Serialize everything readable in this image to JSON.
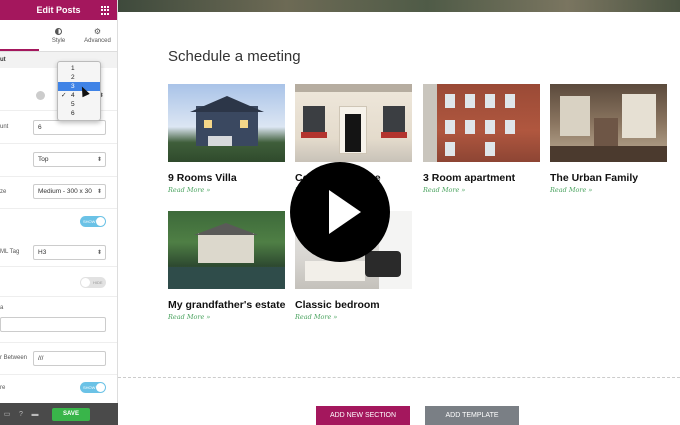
{
  "panel": {
    "title": "Edit Posts",
    "tabs": [
      {
        "label": ""
      },
      {
        "label": "Style",
        "icon": "half-circle-icon"
      },
      {
        "label": "Advanced",
        "icon": "gear-icon"
      }
    ],
    "section_label": "ut",
    "controls": {
      "posts_count_label": "unt",
      "posts_count_value": "6",
      "image_position_value": "Top",
      "image_size_label": "ze",
      "image_size_value": "Medium - 300 x 30",
      "title_tag_label": "ML Tag",
      "title_tag_value": "H3",
      "toggle_on_label": "SHOW",
      "toggle_off_label": "HIDE",
      "meta_label": "a",
      "separator_label": "r Between",
      "separator_value": "///",
      "read_more_label": "re"
    },
    "dropdown": {
      "options": [
        "1",
        "2",
        "3",
        "4",
        "5",
        "6"
      ],
      "highlighted": "3",
      "checked": "4"
    },
    "footer": {
      "save_label": "SAVE"
    }
  },
  "canvas": {
    "heading": "Schedule a meeting",
    "posts": [
      {
        "title": "9 Rooms Villa",
        "link": "Read More »"
      },
      {
        "title": "Cozy Townhouse",
        "link": "Read More »"
      },
      {
        "title": "3 Room apartment",
        "link": "Read More »"
      },
      {
        "title": "The Urban Family",
        "link": "Read More »"
      },
      {
        "title": "My grandfather's estate",
        "link": "Read More »"
      },
      {
        "title": "Classic bedroom",
        "link": "Read More »"
      }
    ],
    "add_section_label": "ADD NEW SECTION",
    "add_template_label": "ADD TEMPLATE"
  },
  "colors": {
    "brand": "#a4175d",
    "save": "#39b54a",
    "read_more": "#4aa35f",
    "toggle": "#6bc2e6"
  }
}
